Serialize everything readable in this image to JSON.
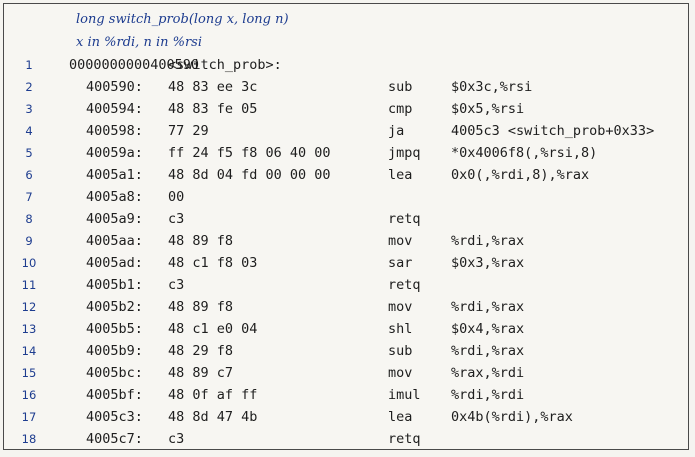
{
  "header": {
    "line1": "long switch_prob(long x, long n)",
    "line2": "x in %rdi, n in %rsi"
  },
  "rows": [
    {
      "num": "1",
      "addr": "0000000000400590",
      "bytes": "<switch_prob>:",
      "mnem": "",
      "ops": ""
    },
    {
      "num": "2",
      "addr": "400590:",
      "bytes": "48 83 ee 3c",
      "mnem": "sub",
      "ops": "$0x3c,%rsi"
    },
    {
      "num": "3",
      "addr": "400594:",
      "bytes": "48 83 fe 05",
      "mnem": "cmp",
      "ops": "$0x5,%rsi"
    },
    {
      "num": "4",
      "addr": "400598:",
      "bytes": "77 29",
      "mnem": "ja",
      "ops": "4005c3 <switch_prob+0x33>"
    },
    {
      "num": "5",
      "addr": "40059a:",
      "bytes": "ff 24 f5 f8 06 40 00",
      "mnem": "jmpq",
      "ops": "*0x4006f8(,%rsi,8)"
    },
    {
      "num": "6",
      "addr": "4005a1:",
      "bytes": "48 8d 04 fd 00 00 00",
      "mnem": "lea",
      "ops": "0x0(,%rdi,8),%rax"
    },
    {
      "num": "7",
      "addr": "4005a8:",
      "bytes": "00",
      "mnem": "",
      "ops": ""
    },
    {
      "num": "8",
      "addr": "4005a9:",
      "bytes": "c3",
      "mnem": "retq",
      "ops": ""
    },
    {
      "num": "9",
      "addr": "4005aa:",
      "bytes": "48 89 f8",
      "mnem": "mov",
      "ops": "%rdi,%rax"
    },
    {
      "num": "10",
      "addr": "4005ad:",
      "bytes": "48 c1 f8 03",
      "mnem": "sar",
      "ops": "$0x3,%rax"
    },
    {
      "num": "11",
      "addr": "4005b1:",
      "bytes": "c3",
      "mnem": "retq",
      "ops": ""
    },
    {
      "num": "12",
      "addr": "4005b2:",
      "bytes": "48 89 f8",
      "mnem": "mov",
      "ops": "%rdi,%rax"
    },
    {
      "num": "13",
      "addr": "4005b5:",
      "bytes": "48 c1 e0 04",
      "mnem": "shl",
      "ops": "$0x4,%rax"
    },
    {
      "num": "14",
      "addr": "4005b9:",
      "bytes": "48 29 f8",
      "mnem": "sub",
      "ops": "%rdi,%rax"
    },
    {
      "num": "15",
      "addr": "4005bc:",
      "bytes": "48 89 c7",
      "mnem": "mov",
      "ops": "%rax,%rdi"
    },
    {
      "num": "16",
      "addr": "4005bf:",
      "bytes": "48 0f af ff",
      "mnem": "imul",
      "ops": "%rdi,%rdi"
    },
    {
      "num": "17",
      "addr": "4005c3:",
      "bytes": "48 8d 47 4b",
      "mnem": "lea",
      "ops": "0x4b(%rdi),%rax"
    },
    {
      "num": "18",
      "addr": "4005c7:",
      "bytes": "c3",
      "mnem": "retq",
      "ops": ""
    }
  ],
  "colors": {
    "accent": "#1d3c8f",
    "text": "#1e1e1e",
    "border": "#4a4a4a"
  }
}
